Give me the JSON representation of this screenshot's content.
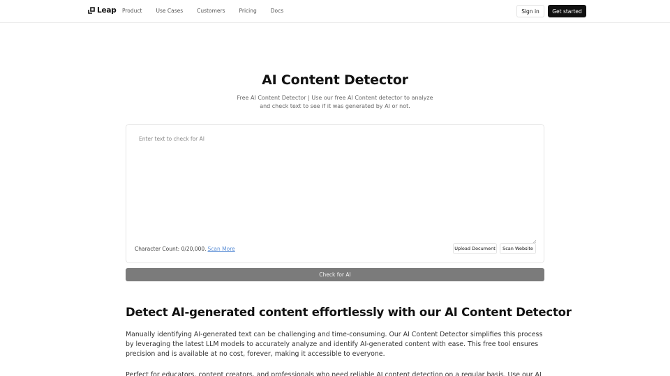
{
  "header": {
    "logo_text": "Leap",
    "nav": [
      "Product",
      "Use Cases",
      "Customers",
      "Pricing",
      "Docs"
    ],
    "signin_label": "Sign in",
    "get_started_label": "Get started"
  },
  "hero": {
    "title": "AI Content Detector",
    "subtitle": "Free AI Content Detector | Use our free AI Content detector to analyze and check text to see if it was generated by AI or not."
  },
  "detector": {
    "placeholder": "Enter text to check for AI",
    "value": "",
    "char_count_label": "Character Count: 0/20,000.",
    "scan_more_label": "Scan More",
    "upload_label": "Upload Document",
    "scan_website_label": "Scan Website",
    "check_label": "Check for AI"
  },
  "content": {
    "heading": "Detect AI-generated content effortlessly with our AI Content Detector",
    "paragraph_1": "Manually identifying AI-generated text can be challenging and time-consuming. Our AI Content Detector simplifies this process by leveraging the latest LLM models to accurately analyze and identify AI-generated content with ease. This free tool ensures precision and is available at no cost, forever, making it accessible to everyone.",
    "paragraph_2": "Perfect for educators, content creators, and professionals who need reliable AI content detection on a regular basis. Use our AI Content"
  },
  "colors": {
    "primary_button": "#111111",
    "check_button": "#7b7b7b",
    "link": "#5c8fd6"
  }
}
